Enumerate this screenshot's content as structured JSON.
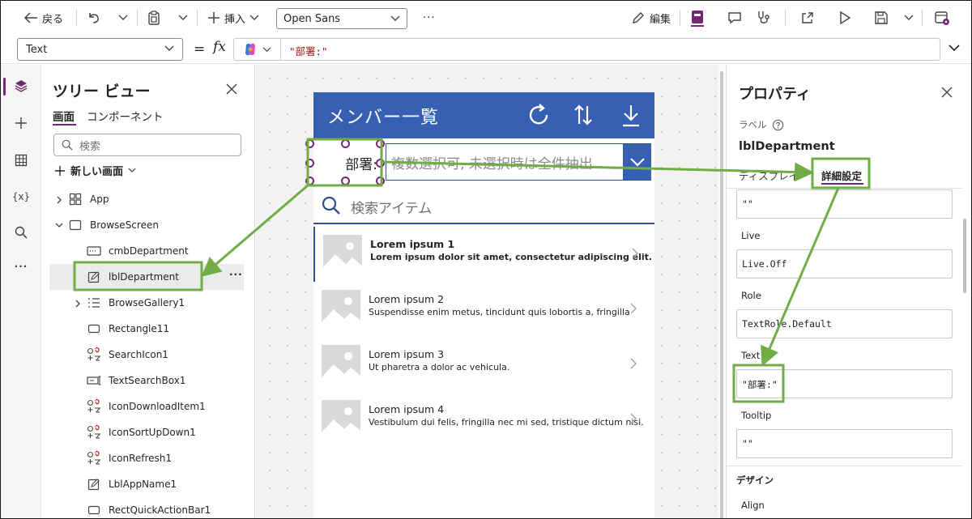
{
  "toolbar": {
    "back_label": "戻る",
    "insert_label": "挿入",
    "font_value": "Open Sans",
    "more_label": "···",
    "edit_label": "編集"
  },
  "formula": {
    "property": "Text",
    "equals": "=",
    "fx": "fx",
    "value": "\"部署:\""
  },
  "tree": {
    "title": "ツリー ビュー",
    "tabs": [
      "画面",
      "コンポーネント"
    ],
    "search_placeholder": "検索",
    "new_screen_label": "新しい画面",
    "nodes": [
      {
        "label": "App"
      },
      {
        "label": "BrowseScreen"
      },
      {
        "label": "cmbDepartment"
      },
      {
        "label": "lblDepartment"
      },
      {
        "label": "BrowseGallery1"
      },
      {
        "label": "Rectangle11"
      },
      {
        "label": "SearchIcon1"
      },
      {
        "label": "TextSearchBox1"
      },
      {
        "label": "IconDownloadItem1"
      },
      {
        "label": "IconSortUpDown1"
      },
      {
        "label": "IconRefresh1"
      },
      {
        "label": "LblAppName1"
      },
      {
        "label": "RectQuickActionBar1"
      }
    ]
  },
  "app": {
    "title": "メンバー一覧",
    "dept_label": "部署:",
    "combo_placeholder": "複数選択可, 未選択時は全件抽出",
    "search_placeholder": "検索アイテム",
    "items": [
      {
        "title": "Lorem ipsum 1",
        "subtitle": "Lorem ipsum dolor sit amet, consectetur adipiscing elit."
      },
      {
        "title": "Lorem ipsum 2",
        "subtitle": "Suspendisse enim metus, tincidunt quis lobortis a, fringilla"
      },
      {
        "title": "Lorem ipsum 3",
        "subtitle": "Ut pharetra a dolor ac vehicula."
      },
      {
        "title": "Lorem ipsum 4",
        "subtitle": "Vestibulum dui felis, fringilla nec mi sed, tristique dictum nisi."
      }
    ]
  },
  "props": {
    "title": "プロパティ",
    "type_label": "ラベル",
    "control_name": "lblDepartment",
    "tabs": [
      "ディスプレイ",
      "詳細設定"
    ],
    "fields": [
      {
        "label": "",
        "value": "\"\""
      },
      {
        "label": "Live",
        "value": "Live.Off"
      },
      {
        "label": "Role",
        "value": "TextRole.Default"
      },
      {
        "label": "Text",
        "value": "\"部署:\""
      },
      {
        "label": "Tooltip",
        "value": "\"\""
      }
    ],
    "design_section": "デザイン",
    "align_label": "Align"
  },
  "colors": {
    "accent": "#742774",
    "app_header": "#3860b2",
    "annotation": "#70ad47",
    "formula_string": "#a31515"
  }
}
